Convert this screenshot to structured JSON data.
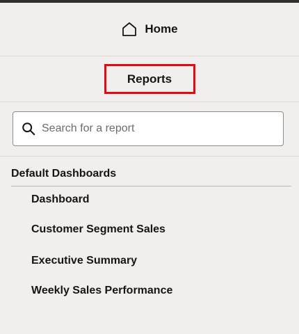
{
  "nav": {
    "home_label": "Home",
    "home_icon": "home-icon"
  },
  "reports": {
    "title": "Reports",
    "highlight_color": "#e00b14"
  },
  "search": {
    "placeholder": "Search for a report",
    "value": "",
    "icon": "search-icon"
  },
  "section": {
    "title": "Default Dashboards",
    "items": [
      {
        "label": "Dashboard"
      },
      {
        "label": "Customer Segment Sales"
      },
      {
        "label": "Executive Summary"
      },
      {
        "label": "Weekly Sales Performance"
      }
    ]
  }
}
